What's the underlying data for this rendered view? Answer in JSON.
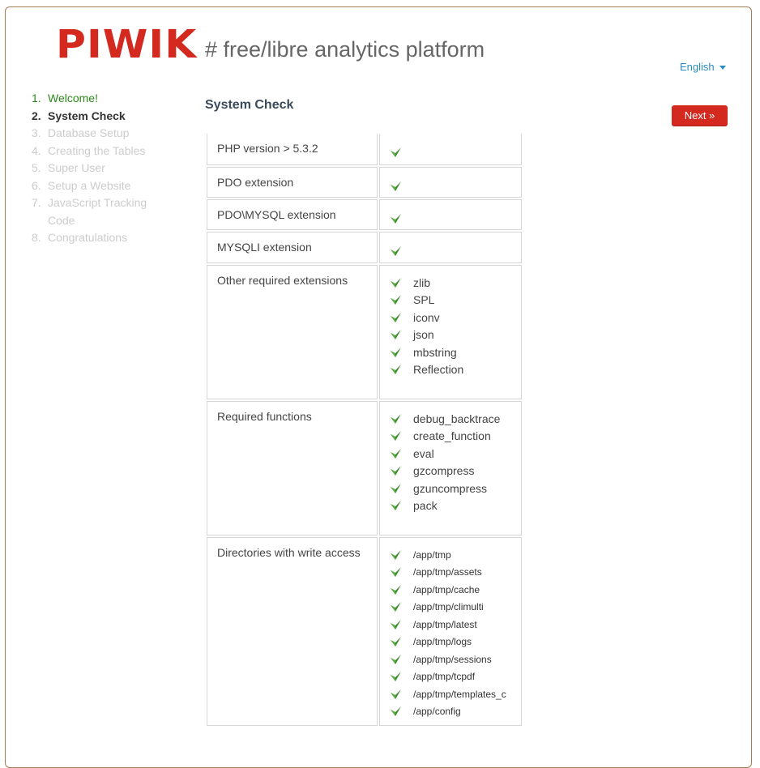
{
  "header": {
    "logo": "PIWIK",
    "tagline": "# free/libre analytics platform",
    "language": "English"
  },
  "steps": [
    {
      "num": "1.",
      "label": "Welcome!"
    },
    {
      "num": "2.",
      "label": "System Check"
    },
    {
      "num": "3.",
      "label": "Database Setup"
    },
    {
      "num": "4.",
      "label": "Creating the Tables"
    },
    {
      "num": "5.",
      "label": "Super User"
    },
    {
      "num": "6.",
      "label": "Setup a Website"
    },
    {
      "num": "7.",
      "label": "JavaScript Tracking Code"
    },
    {
      "num": "8.",
      "label": "Congratulations"
    }
  ],
  "main": {
    "title": "System Check",
    "next_label": "Next »"
  },
  "colors": {
    "brand": "#d4291f",
    "done": "#2c8a1a",
    "link": "#2a8cc4",
    "check": "#3d8c2f"
  },
  "checks": [
    {
      "label": "PHP version > 5.3.2",
      "items": [
        ""
      ]
    },
    {
      "label": "PDO extension",
      "items": [
        ""
      ]
    },
    {
      "label": "PDO\\MYSQL extension",
      "items": [
        ""
      ]
    },
    {
      "label": "MYSQLI extension",
      "items": [
        ""
      ]
    },
    {
      "label": "Other required extensions",
      "items": [
        "zlib",
        "SPL",
        "iconv",
        "json",
        "mbstring",
        "Reflection"
      ]
    },
    {
      "label": "Required functions",
      "items": [
        "debug_backtrace",
        "create_function",
        "eval",
        "gzcompress",
        "gzuncompress",
        "pack"
      ]
    },
    {
      "label": "Directories with write access",
      "items": [
        "/app/tmp",
        "/app/tmp/assets",
        "/app/tmp/cache",
        "/app/tmp/climulti",
        "/app/tmp/latest",
        "/app/tmp/logs",
        "/app/tmp/sessions",
        "/app/tmp/tcpdf",
        "/app/tmp/templates_c",
        "/app/config"
      ]
    }
  ]
}
